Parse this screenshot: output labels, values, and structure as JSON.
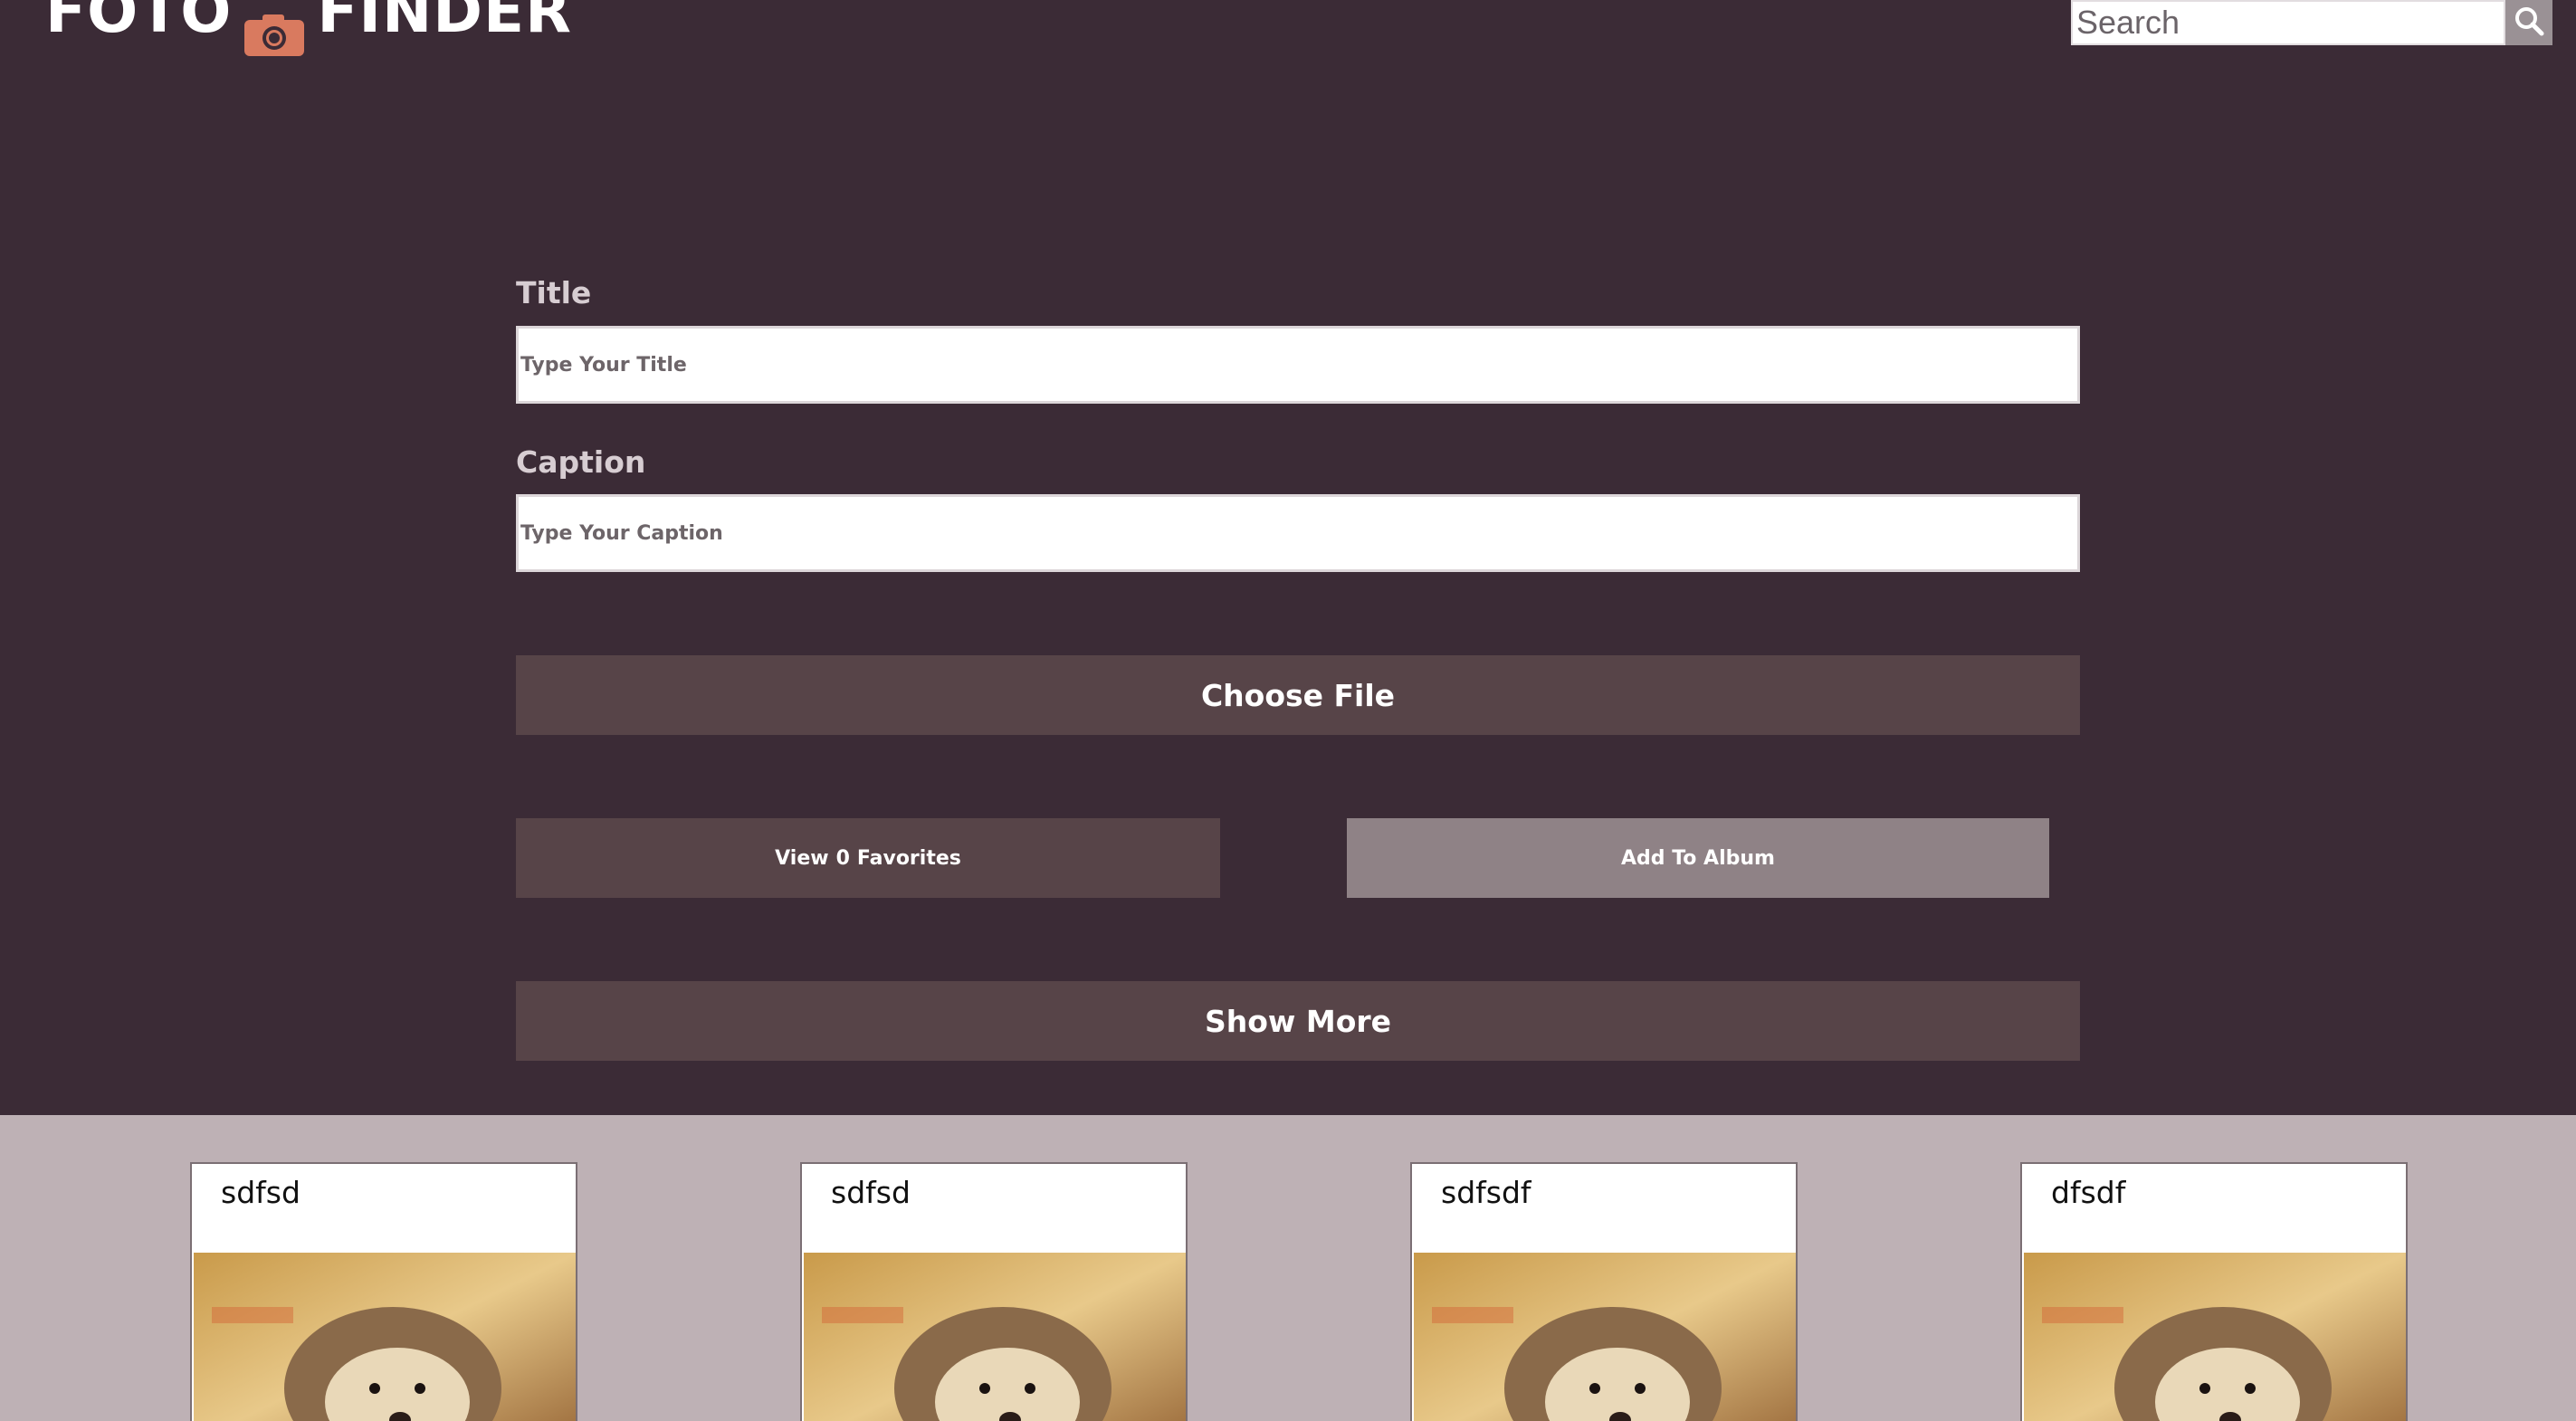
{
  "header": {
    "logo_part1": "FOTO",
    "logo_part2": "FINDER",
    "search_placeholder": "Search"
  },
  "form": {
    "title_label": "Title",
    "title_placeholder": "Type Your Title",
    "caption_label": "Caption",
    "caption_placeholder": "Type Your Caption",
    "choose_file_label": "Choose File",
    "view_favorites_prefix": "View",
    "favorites_count": "0",
    "view_favorites_suffix": "Favorites",
    "add_to_album_label": "Add To Album",
    "show_more_label": "Show More"
  },
  "cards": [
    {
      "title": "sdfsd"
    },
    {
      "title": "sdfsd"
    },
    {
      "title": "sdfsdf"
    },
    {
      "title": "dfsdf"
    }
  ],
  "colors": {
    "background": "#3b2b36",
    "button": "#574448",
    "button_light": "#8f8286",
    "gallery_bg": "#beb1b5",
    "logo_camera": "#d97a5f"
  },
  "icons": {
    "logo": "camera-icon",
    "search": "search-icon"
  }
}
